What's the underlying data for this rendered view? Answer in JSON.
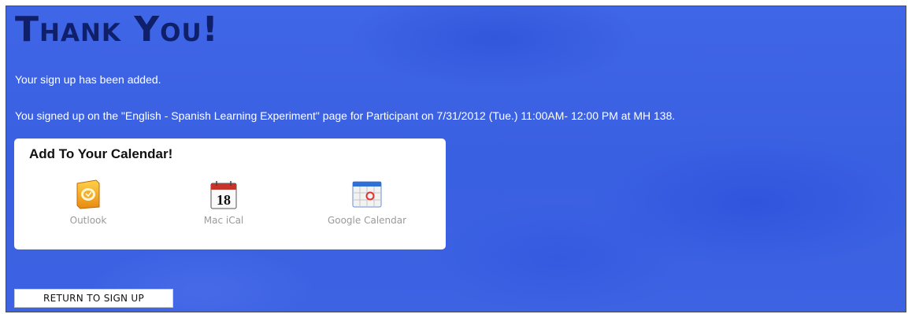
{
  "heading": "Thank You!",
  "messages": {
    "added": "Your sign up has been added.",
    "details": "You signed up on the \"English - Spanish Learning Experiment\" page for Participant on 7/31/2012 (Tue.) 11:00AM- 12:00 PM at MH 138."
  },
  "calendar": {
    "title": "Add To Your Calendar!",
    "items": [
      {
        "label": "Outlook",
        "icon": "outlook-icon"
      },
      {
        "label": "Mac iCal",
        "icon": "ical-icon",
        "day": "18"
      },
      {
        "label": "Google Calendar",
        "icon": "google-calendar-icon"
      }
    ]
  },
  "buttons": {
    "return_label": "RETURN TO SIGN UP"
  },
  "colors": {
    "background": "#3f66e6",
    "heading": "#0f1f6a",
    "message_text": "#ffffff",
    "calendar_label": "#9a9a9a"
  }
}
